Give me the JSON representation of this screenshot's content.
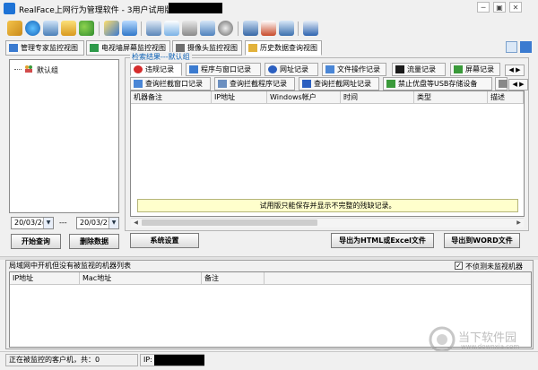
{
  "app": {
    "title": "RealFace上网行为管理软件 - 3用户试用版 IP:",
    "window_controls": [
      "─",
      "▣",
      "✕"
    ]
  },
  "toolbar": {
    "icons": [
      "folder-icon",
      "globe-icon",
      "monitor-icon",
      "mail-icon",
      "users-icon",
      "edit-icon",
      "filter-icon",
      "screen-icon",
      "chat-icon",
      "search-icon",
      "window-icon",
      "camera-icon",
      "save-icon",
      "document-icon",
      "chart-icon",
      "export-icon"
    ]
  },
  "view_tabs": [
    "管理专家监控视图",
    "电视墙屏幕监控视图",
    "摄像头监控视图",
    "历史数据查询视图"
  ],
  "sidebar": {
    "tree_root": "默认组",
    "date_from": "20/03/2(",
    "date_sep": "---",
    "date_to": "20/03/2:",
    "start_button": "开始查询",
    "delete_button": "删除数据"
  },
  "results": {
    "group_title": "检索结果---默认组",
    "tabs_row1": [
      "违规记录",
      "程序与窗口记录",
      "网址记录",
      "文件操作记录",
      "流量记录",
      "屏幕记录"
    ],
    "tabs_row2": [
      "查询拦截窗口记录",
      "查询拦截程序记录",
      "查询拦截网址记录",
      "禁止优盘等USB存储设备"
    ],
    "scroll_left": "◀",
    "scroll_right": "▶",
    "columns": [
      "机器备注",
      "IP地址",
      "Windows帐户",
      "时间",
      "类型",
      "描述"
    ],
    "notice": "试用版只能保存并显示不完整的残缺记录。"
  },
  "actions": {
    "settings": "系统设置",
    "export_html_excel": "导出为HTML或Excel文件",
    "export_word": "导出到WORD文件"
  },
  "bottom": {
    "title": "局域网中开机但没有被监视的机器列表",
    "checkbox_label": "不侦测未监视机器",
    "checkbox_checked": true,
    "columns": [
      "IP地址",
      "Mac地址",
      "备注"
    ]
  },
  "status": {
    "clients": "正在被监控的客户机，共：0",
    "ip_label": "IP:"
  },
  "watermark": {
    "brand": "当下软件园",
    "url": "www.downxia.com"
  }
}
